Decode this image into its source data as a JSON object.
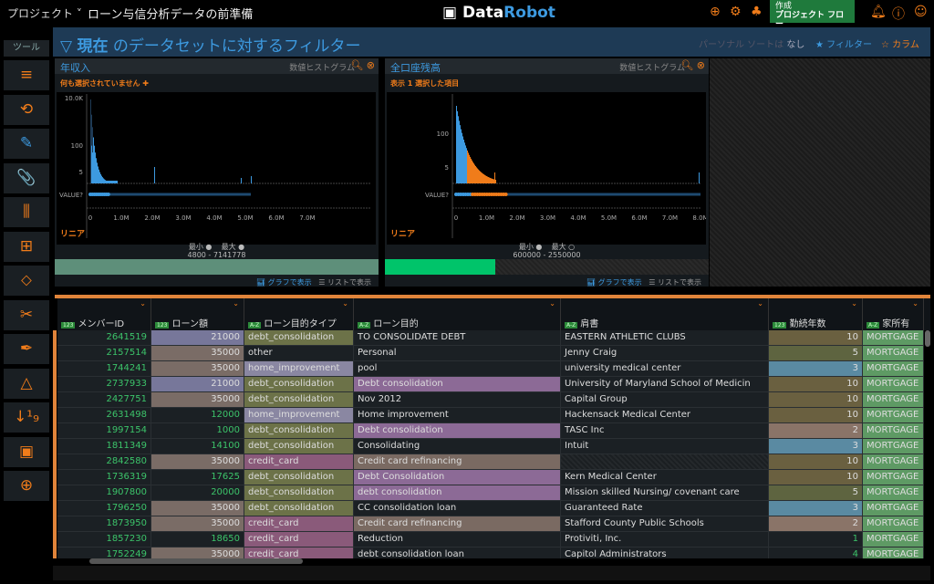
{
  "header": {
    "project_menu": "プロジェクト ˅",
    "title": "ローン与信分析データの前準備",
    "logo_a": "Data",
    "logo_b": "Robot",
    "flow_small": "作成",
    "flow_label": "プロジェクト フロー"
  },
  "sidebar": {
    "tools_label": "ツール",
    "icons": [
      "≡",
      "⟲",
      "✎",
      "📎",
      "⫼",
      "⊞",
      "⬦",
      "✂",
      "✒",
      "△",
      "↓¹₉",
      "▣",
      "⊕"
    ]
  },
  "filter": {
    "title_bold": "現在",
    "title_rest": " のデータセットに対するフィルター",
    "sort_text": "パーソナル ソートは",
    "sort_value": "なし",
    "filter_btn": "★ フィルター",
    "column_btn": "☆ カラム"
  },
  "panels": [
    {
      "name": "年収入",
      "kind": "数値ヒストグラム",
      "selection": "何も選択されていません ✚",
      "scale": "リニア",
      "min_label": "最小 ●",
      "max_label": "最大 ●",
      "range": "4800  -  7141778",
      "progress": 1.0,
      "bar_color": "#5e8f7a",
      "y_ticks": [
        "10.0K",
        "100",
        "5"
      ],
      "x_ticks": [
        "0",
        "1.0M",
        "2.0M",
        "3.0M",
        "4.0M",
        "5.0M",
        "6.0M",
        "7.0M"
      ],
      "value_label": "VALUE?",
      "graph_btn": "グラフで表示",
      "list_btn": "リストで表示"
    },
    {
      "name": "全口座残高",
      "kind": "数値ヒストグラム",
      "selection": "表示 1 選択した項目",
      "scale": "リニア",
      "min_label": "最小 ●",
      "max_label": "最大 ○",
      "range": "600000  -  2550000",
      "progress": 0.34,
      "bar_color": "#00c46a",
      "y_ticks": [
        "100",
        "5"
      ],
      "x_ticks": [
        "0",
        "1.0M",
        "2.0M",
        "3.0M",
        "4.0M",
        "5.0M",
        "6.0M",
        "7.0M",
        "8.0M"
      ],
      "value_label": "VALUE?",
      "graph_btn": "グラフで表示",
      "list_btn": "リストで表示"
    }
  ],
  "table": {
    "columns": [
      {
        "type": "123",
        "label": "メンバーID"
      },
      {
        "type": "123",
        "label": "ローン額"
      },
      {
        "type": "A-Z",
        "label": "ローン目的タイプ"
      },
      {
        "type": "A-Z",
        "label": "ローン目的"
      },
      {
        "type": "A-Z",
        "label": "肩書"
      },
      {
        "type": "123",
        "label": "勤続年数"
      },
      {
        "type": "A-Z",
        "label": "家所有"
      }
    ],
    "rows": [
      [
        "2641519",
        "21000",
        "debt_consolidation",
        "TO CONSOLIDATE DEBT",
        "EASTERN ATHLETIC CLUBS",
        "10",
        "MORTGAGE"
      ],
      [
        "2157514",
        "35000",
        "other",
        "Personal",
        "Jenny Craig",
        "5",
        "MORTGAGE"
      ],
      [
        "1744241",
        "35000",
        "home_improvement",
        "pool",
        "university medical center",
        "3",
        "MORTGAGE"
      ],
      [
        "2737933",
        "21000",
        "debt_consolidation",
        "Debt consolidation",
        "University of Maryland School of Medicin",
        "10",
        "MORTGAGE"
      ],
      [
        "2427751",
        "35000",
        "debt_consolidation",
        "Nov 2012",
        "Capital Group",
        "10",
        "MORTGAGE"
      ],
      [
        "2631498",
        "12000",
        "home_improvement",
        "Home improvement",
        "Hackensack Medical Center",
        "10",
        "MORTGAGE"
      ],
      [
        "1997154",
        "1000",
        "debt_consolidation",
        "Debt consolidation",
        "TASC Inc",
        "2",
        "MORTGAGE"
      ],
      [
        "1811349",
        "14100",
        "debt_consolidation",
        "Consolidating",
        "Intuit",
        "3",
        "MORTGAGE"
      ],
      [
        "2842580",
        "35000",
        "credit_card",
        "Credit card refinancing",
        "",
        "10",
        "MORTGAGE"
      ],
      [
        "1736319",
        "17625",
        "debt_consolidation",
        "Debt Consolidation",
        "Kern Medical Center",
        "10",
        "MORTGAGE"
      ],
      [
        "1907800",
        "20000",
        "debt_consolidation",
        "debt consolidation",
        "Mission skilled Nursing/ covenant care",
        "5",
        "MORTGAGE"
      ],
      [
        "1796250",
        "35000",
        "debt_consolidation",
        "CC consolidation loan",
        "Guaranteed Rate",
        "3",
        "MORTGAGE"
      ],
      [
        "1873950",
        "35000",
        "credit_card",
        "Credit card refinancing",
        "Stafford County Public Schools",
        "2",
        "MORTGAGE"
      ],
      [
        "1857230",
        "18650",
        "credit_card",
        "Reduction",
        "Protiviti, Inc.",
        "1",
        "MORTGAGE"
      ],
      [
        "1752249",
        "35000",
        "credit_card",
        "debt consolidation loan",
        "Capitol Administrators",
        "4",
        "MORTGAGE"
      ]
    ],
    "colors": {
      "1": {
        "21000": "#77779a",
        "35000": "#7a6c66"
      },
      "2": {
        "debt_consolidation": "#6c7248",
        "home_improvement": "#8a87a2",
        "credit_card": "#8a5a7a"
      },
      "3": {
        "Debt consolidation": "#8c6a96",
        "Debt Consolidation": "#8c6a96",
        "debt consolidation": "#8c6a96",
        "Credit card refinancing": "#7a6a62"
      },
      "5": {
        "10": "#6a6040",
        "5": "#5e6440",
        "3": "#5a8aa2",
        "2": "#8a7468"
      },
      "6": {
        "MORTGAGE": "#5e9a64"
      }
    },
    "id_color": "#3cc46a"
  }
}
